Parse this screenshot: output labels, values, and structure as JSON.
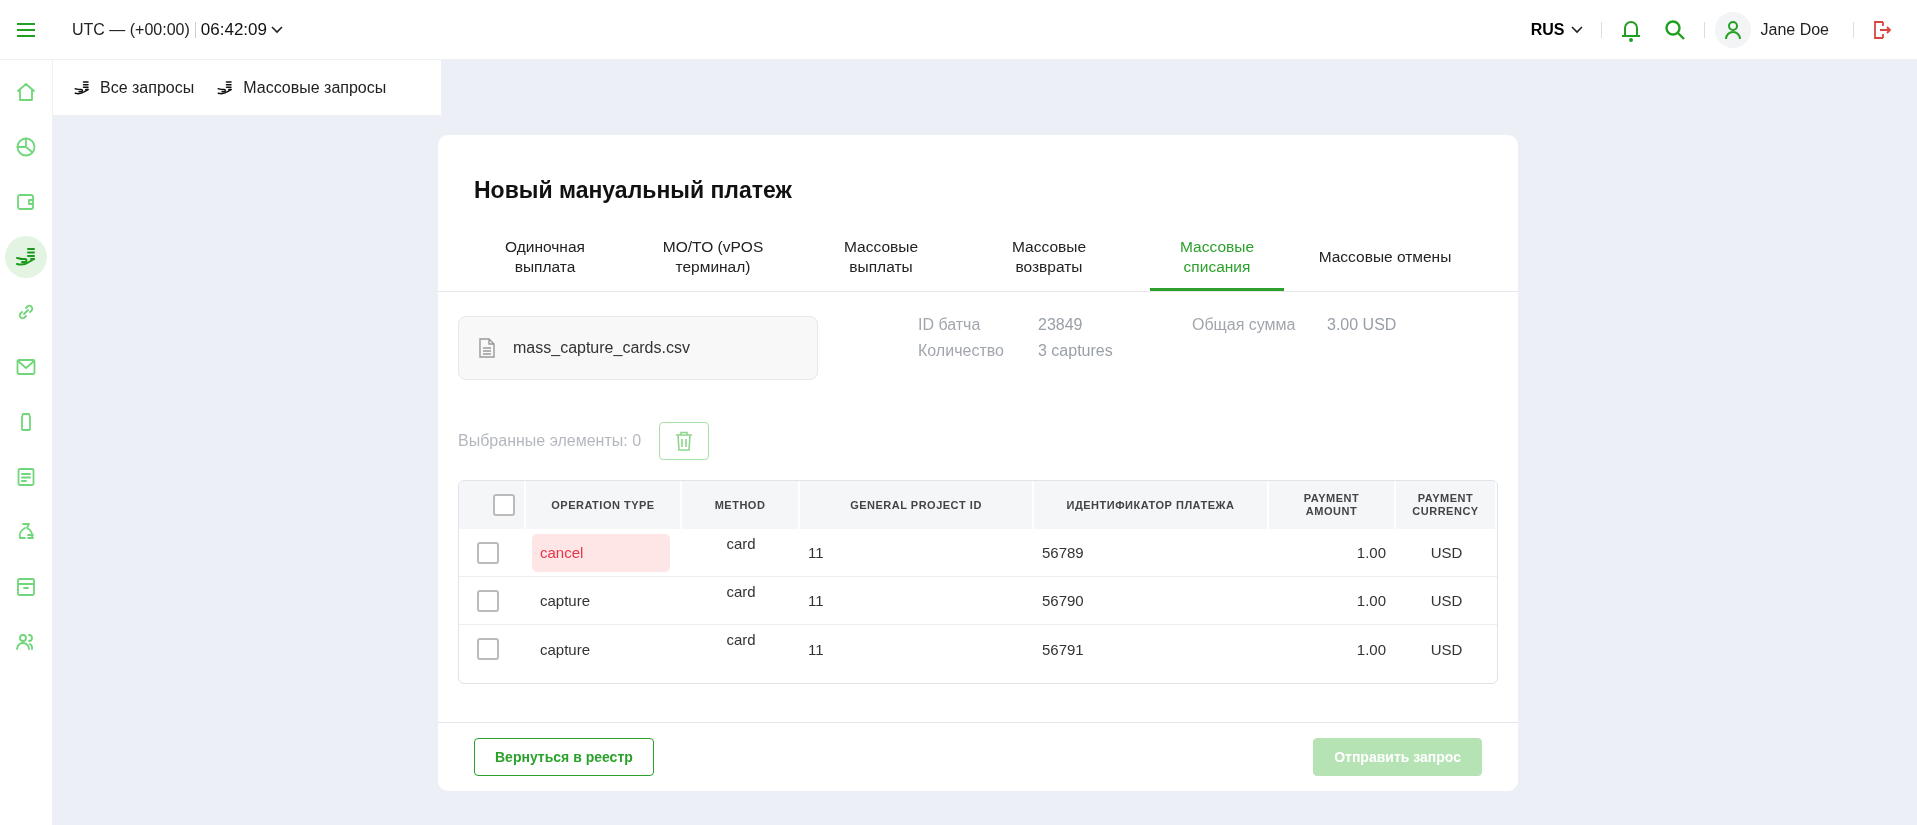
{
  "topbar": {
    "timezone": "UTC — (+00:00)",
    "time": "06:42:09",
    "language": "RUS",
    "user": "Jane Doe"
  },
  "sidebar": {
    "items": [
      {
        "selected": false
      },
      {
        "selected": false
      },
      {
        "selected": false
      },
      {
        "selected": true
      },
      {
        "selected": false
      },
      {
        "selected": false
      },
      {
        "selected": false
      },
      {
        "selected": false
      },
      {
        "selected": false
      },
      {
        "selected": false
      },
      {
        "selected": false
      }
    ]
  },
  "subnav": [
    "Все запросы",
    "Массовые запросы"
  ],
  "card": {
    "title": "Новый мануальный платеж",
    "tabs": [
      {
        "label": "Одиночная выплата",
        "selected": false
      },
      {
        "label": "MO/TO (vPOS терминал)",
        "selected": false
      },
      {
        "label": "Массовые выплаты",
        "selected": false
      },
      {
        "label": "Массовые возвраты",
        "selected": false
      },
      {
        "label": "Массовые списания",
        "selected": true
      },
      {
        "label": "Массовые отмены",
        "selected": false
      }
    ],
    "file": "mass_capture_cards.csv",
    "info": [
      {
        "label": "ID батча",
        "value": "23849"
      },
      {
        "label": "Количество",
        "value": "3 captures"
      },
      {
        "label": "Общая сумма",
        "value": "3.00 USD"
      }
    ],
    "selected_count": "Выбранные элементы: 0",
    "table": {
      "header_checked": false,
      "columns": [
        "OPERATION TYPE",
        "METHOD",
        "GENERAL PROJECT ID",
        "ИДЕНТИФИКАТОР ПЛАТЕЖА",
        "PAYMENT AMOUNT",
        "PAYMENT CURRENCY"
      ],
      "rows": [
        {
          "checked": false,
          "invalid": true,
          "cells": [
            "cancel",
            "card",
            "11",
            "56789",
            "1.00",
            "USD"
          ]
        },
        {
          "checked": false,
          "invalid": false,
          "cells": [
            "capture",
            "card",
            "11",
            "56790",
            "1.00",
            "USD"
          ]
        },
        {
          "checked": false,
          "invalid": false,
          "cells": [
            "capture",
            "card",
            "11",
            "56791",
            "1.00",
            "USD"
          ]
        }
      ]
    },
    "buttons": [
      {
        "label": "Вернуться в реестр",
        "disabled": false
      },
      {
        "label": "Отправить запрос",
        "disabled": true
      }
    ]
  }
}
